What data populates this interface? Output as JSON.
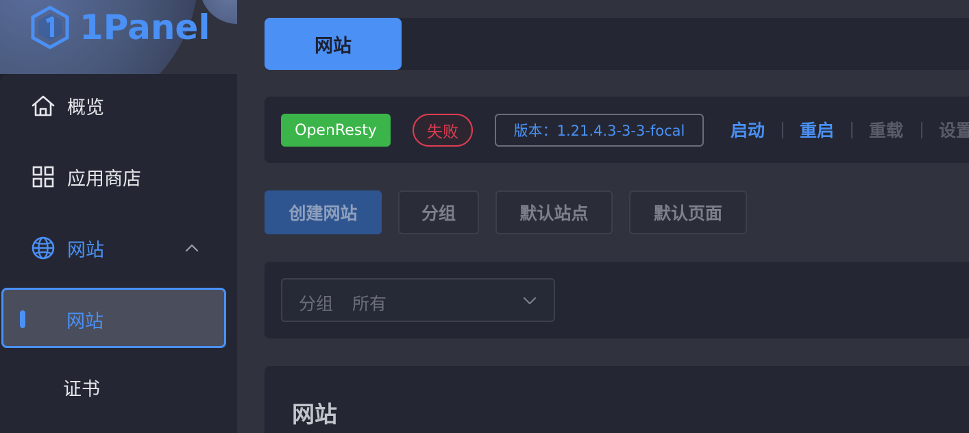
{
  "brand": {
    "name": "1Panel",
    "accent": "#4a90f5"
  },
  "sidebar": {
    "items": [
      {
        "label": "概览",
        "icon": "home-icon"
      },
      {
        "label": "应用商店",
        "icon": "grid-icon"
      },
      {
        "label": "网站",
        "icon": "globe-icon",
        "expanded": true
      }
    ],
    "sub_items": [
      {
        "label": "网站",
        "active": true
      },
      {
        "label": "证书",
        "active": false
      }
    ]
  },
  "tabs": [
    {
      "label": "网站",
      "active": true
    }
  ],
  "app_status": {
    "app_name": "OpenResty",
    "status": "失败",
    "version": "版本：1.21.4.3-3-3-focal",
    "actions": [
      "启动",
      "重启",
      "重载",
      "设置"
    ],
    "colors": {
      "app_tag": "#3bb54a",
      "status": "#e03c52"
    }
  },
  "toolbar": {
    "create": "创建网站",
    "group": "分组",
    "default_site": "默认站点",
    "default_page": "默认页面"
  },
  "filter": {
    "prefix": "分组",
    "value": "所有"
  },
  "panel": {
    "title": "网站"
  }
}
